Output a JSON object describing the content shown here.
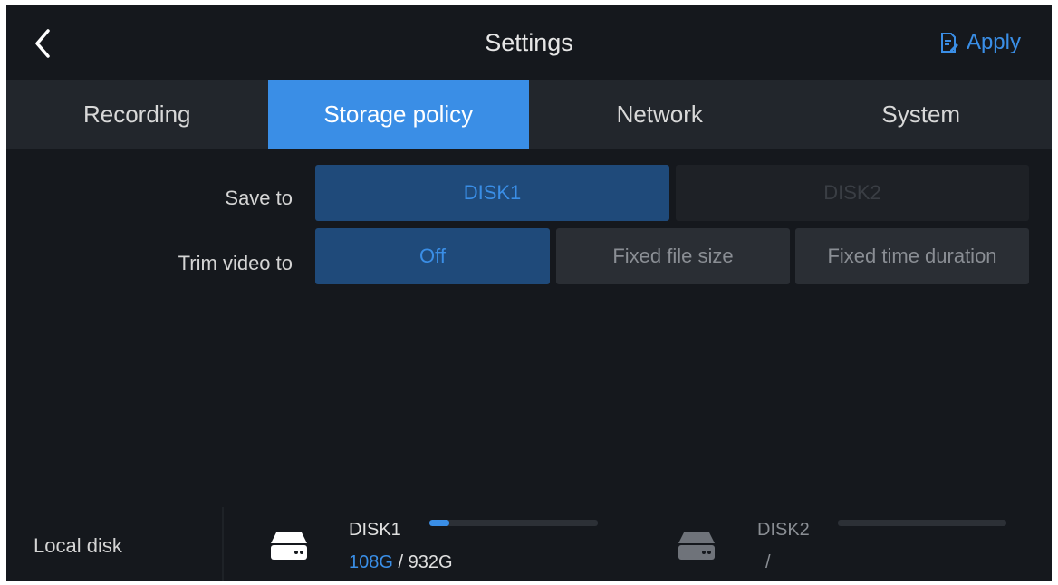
{
  "header": {
    "title": "Settings",
    "apply_label": "Apply"
  },
  "tabs": [
    {
      "label": "Recording",
      "active": false
    },
    {
      "label": "Storage policy",
      "active": true
    },
    {
      "label": "Network",
      "active": false
    },
    {
      "label": "System",
      "active": false
    }
  ],
  "form": {
    "save_to": {
      "label": "Save to",
      "options": [
        {
          "label": "DISK1",
          "state": "selected"
        },
        {
          "label": "DISK2",
          "state": "disabled"
        }
      ]
    },
    "trim_video": {
      "label": "Trim video to",
      "options": [
        {
          "label": "Off",
          "state": "selected"
        },
        {
          "label": "Fixed file size",
          "state": "normal"
        },
        {
          "label": "Fixed time duration",
          "state": "normal"
        }
      ]
    }
  },
  "local_disk": {
    "label": "Local disk",
    "disks": [
      {
        "name": "DISK1",
        "used": "108G",
        "separator": " / ",
        "total": "932G",
        "usage_fraction": 0.116
      },
      {
        "name": "DISK2",
        "used": "",
        "separator": "/",
        "total": "",
        "usage_fraction": 0
      }
    ]
  },
  "colors": {
    "accent": "#3a8ee6",
    "background": "#15181d",
    "tab_bar": "#22262c",
    "selected_option": "#1f4a7a"
  }
}
